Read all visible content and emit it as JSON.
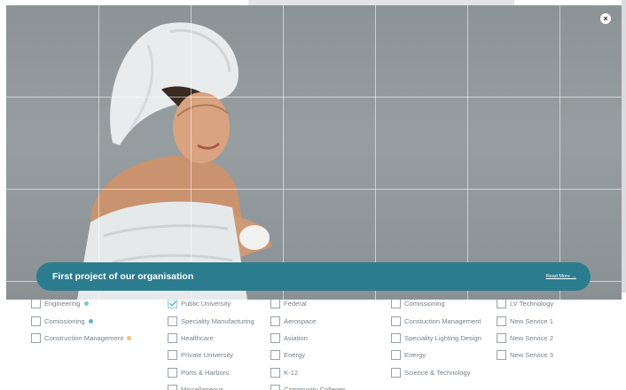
{
  "modal": {
    "close_label": "×",
    "caption_title": "First project of our organisation",
    "read_more": "Read More →"
  },
  "filters": {
    "col1": [
      {
        "label": "Engineering",
        "dot": "#7dc6d8",
        "checked": false
      },
      {
        "label": "Comissioning",
        "dot": "#5fb4d0",
        "checked": false
      },
      {
        "label": "Construction Management",
        "dot": "#f5c27a",
        "checked": false
      }
    ],
    "col2": [
      {
        "label": "Public University",
        "checked": true
      },
      {
        "label": "Speciality Manufacturing",
        "checked": false
      },
      {
        "label": "Healthcare",
        "checked": false
      },
      {
        "label": "Private University",
        "checked": false
      },
      {
        "label": "Ports & Harbors",
        "checked": false
      },
      {
        "label": "Miscellaneous",
        "checked": false
      }
    ],
    "col3": [
      {
        "label": "Federal",
        "checked": false
      },
      {
        "label": "Aerospace",
        "checked": false
      },
      {
        "label": "Aviation",
        "checked": false
      },
      {
        "label": "Energy",
        "checked": false
      },
      {
        "label": "K-12",
        "checked": false
      },
      {
        "label": "Community Colleges",
        "checked": false
      }
    ],
    "col4": [
      {
        "label": "Comissioning",
        "checked": false
      },
      {
        "label": "Constuction Management",
        "checked": false
      },
      {
        "label": "Speciality Lighting Design",
        "checked": false
      },
      {
        "label": "Energy",
        "checked": false
      },
      {
        "label": "Science & Technology",
        "checked": false
      }
    ],
    "col5": [
      {
        "label": "LV Technology",
        "checked": false
      },
      {
        "label": "New Service 1",
        "checked": false
      },
      {
        "label": "New Service 2",
        "checked": false
      },
      {
        "label": "New Service 3",
        "checked": false
      }
    ]
  },
  "icons": {
    "close": "close-icon",
    "checkbox": "checkbox",
    "woman": "woman-with-towel-photo"
  }
}
